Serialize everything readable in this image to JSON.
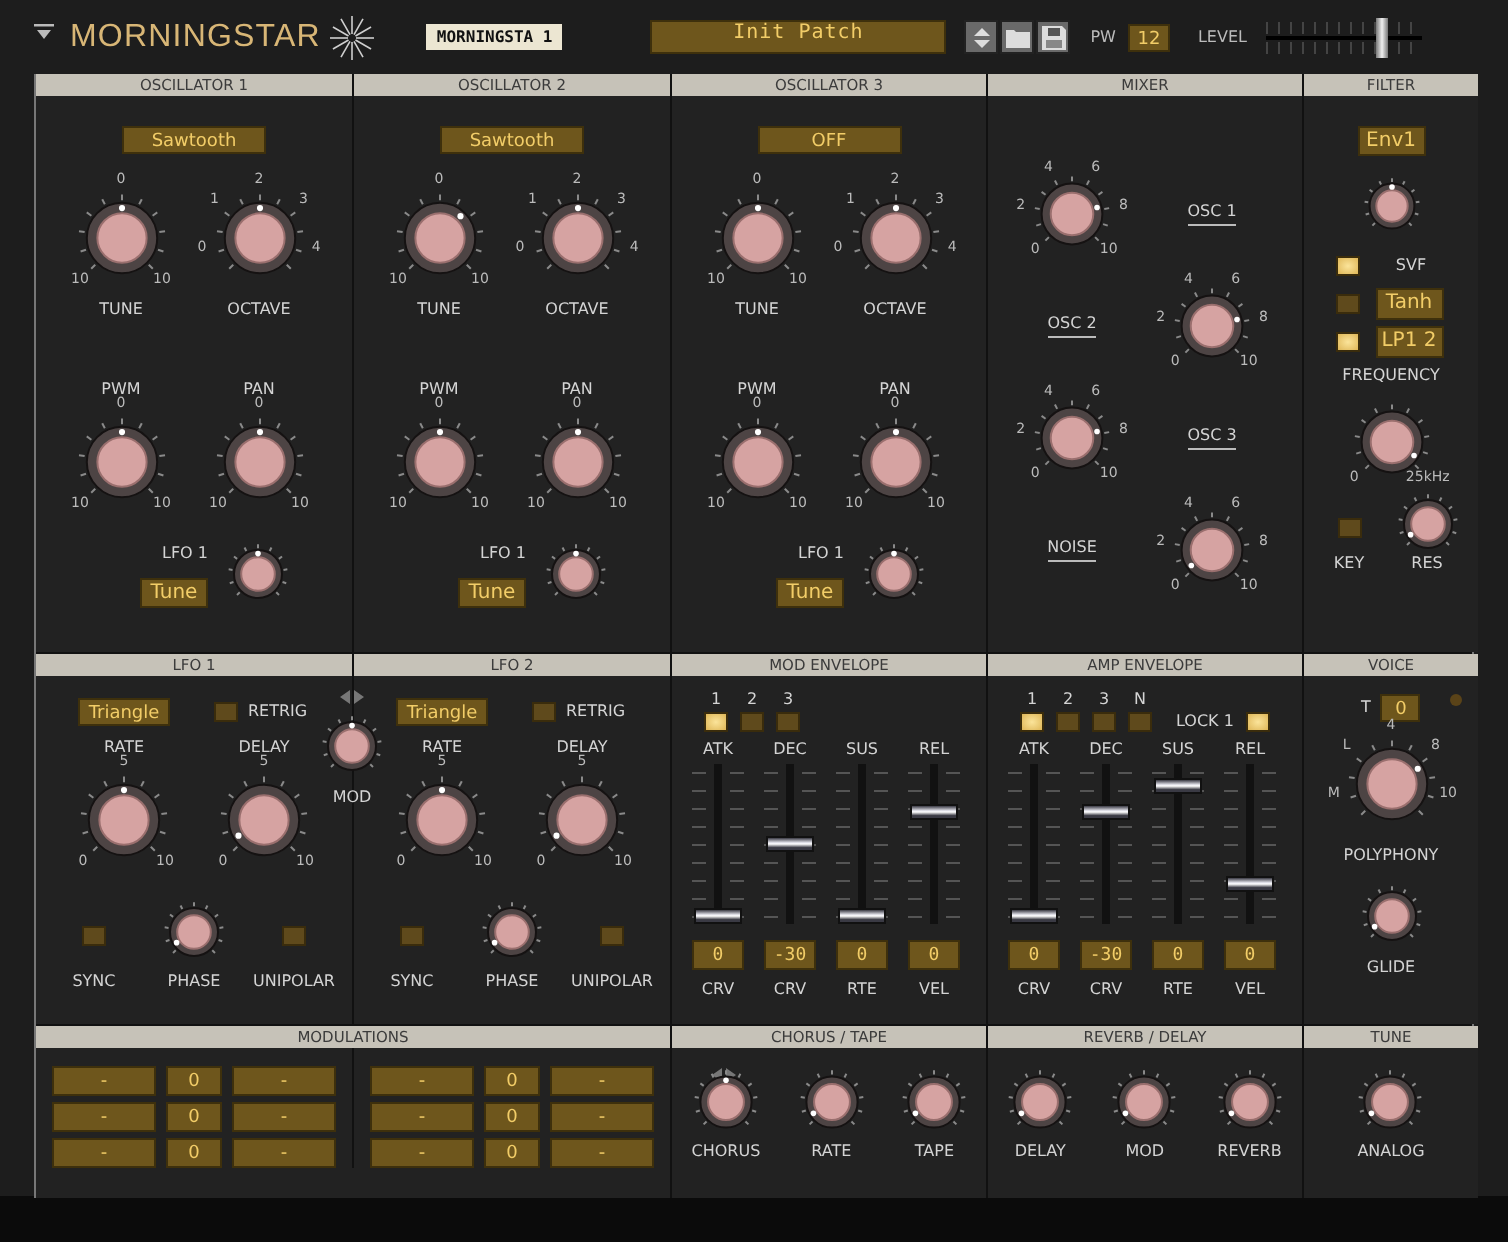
{
  "header": {
    "logo": "MORNINGSTAR",
    "patch_tag": "MORNINGSTA 1",
    "patch_name": "Init Patch",
    "pw_label": "PW",
    "pw_value": "12",
    "level_label": "LEVEL",
    "level": 0.78
  },
  "oscillators": [
    {
      "title": "OSCILLATOR 1",
      "waveform": "Sawtooth",
      "knobs": [
        {
          "label": "TUNE",
          "scale": [
            "10",
            "0",
            "10"
          ]
        },
        {
          "label": "OCTAVE",
          "scale": [
            "0",
            "1",
            "2",
            "3",
            "4"
          ]
        },
        {
          "label": "PWM",
          "scale": [
            "10",
            "0",
            "10"
          ]
        },
        {
          "label": "PAN",
          "scale": [
            "10",
            "0",
            "10"
          ]
        }
      ],
      "lfo_label": "LFO 1",
      "lfo_target": "Tune"
    },
    {
      "title": "OSCILLATOR 2",
      "waveform": "Sawtooth",
      "knobs": [
        {
          "label": "TUNE",
          "scale": [
            "10",
            "0",
            "10"
          ]
        },
        {
          "label": "OCTAVE",
          "scale": [
            "0",
            "1",
            "2",
            "3",
            "4"
          ]
        },
        {
          "label": "PWM",
          "scale": [
            "10",
            "0",
            "10"
          ]
        },
        {
          "label": "PAN",
          "scale": [
            "10",
            "0",
            "10"
          ]
        }
      ],
      "lfo_label": "LFO 1",
      "lfo_target": "Tune"
    },
    {
      "title": "OSCILLATOR 3",
      "waveform": "OFF",
      "knobs": [
        {
          "label": "TUNE",
          "scale": [
            "10",
            "0",
            "10"
          ]
        },
        {
          "label": "OCTAVE",
          "scale": [
            "0",
            "1",
            "2",
            "3",
            "4"
          ]
        },
        {
          "label": "PWM",
          "scale": [
            "10",
            "0",
            "10"
          ]
        },
        {
          "label": "PAN",
          "scale": [
            "10",
            "0",
            "10"
          ]
        }
      ],
      "lfo_label": "LFO 1",
      "lfo_target": "Tune"
    }
  ],
  "mixer": {
    "title": "MIXER",
    "channels": [
      {
        "label": "OSC 1",
        "scale": [
          "0",
          "2",
          "4",
          "6",
          "8",
          "10"
        ]
      },
      {
        "label": "OSC 2",
        "scale": [
          "0",
          "2",
          "4",
          "6",
          "8",
          "10"
        ]
      },
      {
        "label": "OSC 3",
        "scale": [
          "0",
          "2",
          "4",
          "6",
          "8",
          "10"
        ]
      },
      {
        "label": "NOISE",
        "scale": [
          "0",
          "2",
          "4",
          "6",
          "8",
          "10"
        ]
      }
    ]
  },
  "filter": {
    "title": "FILTER",
    "env_source": "Env1",
    "modes": [
      {
        "label": "SVF",
        "on": true,
        "kind": "text"
      },
      {
        "label": "Tanh",
        "on": false,
        "kind": "display"
      },
      {
        "label": "LP1 2",
        "on": true,
        "kind": "display"
      }
    ],
    "frequency": {
      "label": "FREQUENCY",
      "scale": [
        "0",
        "25kHz"
      ]
    },
    "key": {
      "label": "KEY",
      "on": false
    },
    "res": {
      "label": "RES"
    }
  },
  "lfos": [
    {
      "title": "LFO 1",
      "waveform": "Triangle",
      "retrig": {
        "label": "RETRIG",
        "on": false
      },
      "rate": {
        "label": "RATE",
        "scale": [
          "0",
          "5",
          "10"
        ]
      },
      "delay": {
        "label": "DELAY",
        "scale": [
          "0",
          "5",
          "10"
        ]
      },
      "sync": {
        "label": "SYNC",
        "on": false
      },
      "phase": {
        "label": "PHASE"
      },
      "unipolar": {
        "label": "UNIPOLAR",
        "on": false
      }
    },
    {
      "title": "LFO 2",
      "waveform": "Triangle",
      "retrig": {
        "label": "RETRIG",
        "on": false
      },
      "rate": {
        "label": "RATE",
        "scale": [
          "0",
          "5",
          "10"
        ]
      },
      "delay": {
        "label": "DELAY",
        "scale": [
          "0",
          "5",
          "10"
        ]
      },
      "sync": {
        "label": "SYNC",
        "on": false
      },
      "phase": {
        "label": "PHASE"
      },
      "unipolar": {
        "label": "UNIPOLAR",
        "on": false
      }
    }
  ],
  "lfo_mod": {
    "label": "MOD"
  },
  "envelopes": [
    {
      "title": "MOD ENVELOPE",
      "stages": [
        {
          "label": "1",
          "selected": true
        },
        {
          "label": "2",
          "selected": false
        },
        {
          "label": "3",
          "selected": false
        }
      ],
      "faders": [
        {
          "label": "ATK",
          "level": 0.0,
          "value": "0",
          "sublabel": "CRV"
        },
        {
          "label": "DEC",
          "level": 0.5,
          "value": "-30",
          "sublabel": "CRV"
        },
        {
          "label": "SUS",
          "level": 0.0,
          "value": "0",
          "sublabel": "RTE"
        },
        {
          "label": "REL",
          "level": 0.72,
          "value": "0",
          "sublabel": "VEL"
        }
      ]
    },
    {
      "title": "AMP ENVELOPE",
      "stages": [
        {
          "label": "1",
          "selected": true
        },
        {
          "label": "2",
          "selected": false
        },
        {
          "label": "3",
          "selected": false
        },
        {
          "label": "N",
          "selected": false
        }
      ],
      "lock": {
        "label": "LOCK 1",
        "on": true
      },
      "faders": [
        {
          "label": "ATK",
          "level": 0.0,
          "value": "0",
          "sublabel": "CRV"
        },
        {
          "label": "DEC",
          "level": 0.72,
          "value": "-30",
          "sublabel": "CRV"
        },
        {
          "label": "SUS",
          "level": 0.9,
          "value": "0",
          "sublabel": "RTE"
        },
        {
          "label": "REL",
          "level": 0.22,
          "value": "0",
          "sublabel": "VEL"
        }
      ]
    }
  ],
  "voice": {
    "title": "VOICE",
    "t_label": "T",
    "t_value": "0",
    "led_on": false,
    "polyphony": {
      "label": "POLYPHONY",
      "scale": [
        "M",
        "L",
        "4",
        "8",
        "10"
      ]
    },
    "glide": {
      "label": "GLIDE"
    }
  },
  "modulations": {
    "title": "MODULATIONS",
    "groups": [
      [
        {
          "source": "-",
          "amount": "0",
          "target": "-"
        },
        {
          "source": "-",
          "amount": "0",
          "target": "-"
        },
        {
          "source": "-",
          "amount": "0",
          "target": "-"
        }
      ],
      [
        {
          "source": "-",
          "amount": "0",
          "target": "-"
        },
        {
          "source": "-",
          "amount": "0",
          "target": "-"
        },
        {
          "source": "-",
          "amount": "0",
          "target": "-"
        }
      ]
    ]
  },
  "effects": [
    {
      "title": "CHORUS / TAPE",
      "knobs": [
        {
          "label": "CHORUS"
        },
        {
          "label": "RATE"
        },
        {
          "label": "TAPE"
        }
      ]
    },
    {
      "title": "REVERB / DELAY",
      "knobs": [
        {
          "label": "DELAY"
        },
        {
          "label": "MOD"
        },
        {
          "label": "REVERB"
        }
      ]
    },
    {
      "title": "TUNE",
      "knobs": [
        {
          "label": "ANALOG"
        }
      ]
    }
  ]
}
